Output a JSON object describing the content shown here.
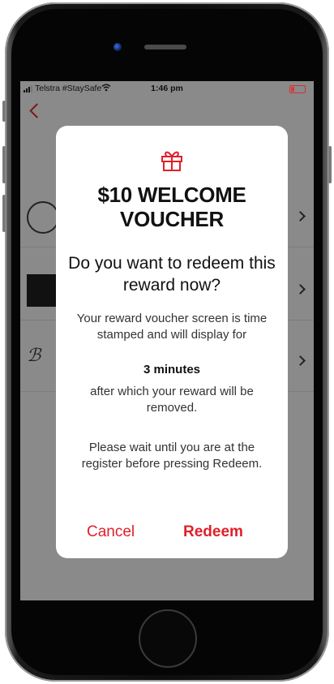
{
  "status_bar": {
    "carrier": "Telstra #StaySafe",
    "time": "1:46 pm"
  },
  "dialog": {
    "title": "$10 WELCOME VOUCHER",
    "question": "Do you want to redeem this reward now?",
    "body1": "Your reward voucher screen is time stamped and will display for",
    "duration": "3 minutes",
    "body2": "after which your reward will be removed.",
    "body3": "Please wait until you are at the register before pressing Redeem.",
    "cancel_label": "Cancel",
    "redeem_label": "Redeem"
  },
  "colors": {
    "accent": "#e0202a",
    "overlay": "#8a8a8a"
  },
  "icons": {
    "gift": "gift-icon",
    "back": "chevron-left-icon",
    "row_arrow": "chevron-right-icon"
  }
}
